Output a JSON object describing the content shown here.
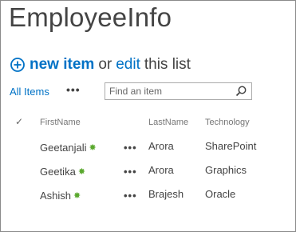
{
  "list": {
    "title": "EmployeeInfo"
  },
  "actions": {
    "new_item_label": "new item",
    "or_text": "or",
    "edit_label": "edit",
    "this_list_text": "this list"
  },
  "views": {
    "current_view": "All Items",
    "more_views_label": "•••"
  },
  "search": {
    "placeholder": "Find an item"
  },
  "table": {
    "check_header": "✓",
    "columns": [
      "FirstName",
      "LastName",
      "Technology"
    ],
    "rows": [
      {
        "first": "Geetanjali",
        "last": "Arora",
        "tech": "SharePoint",
        "new_badge": "✸",
        "menu": "•••"
      },
      {
        "first": "Geetika",
        "last": "Arora",
        "tech": "Graphics",
        "new_badge": "✸",
        "menu": "•••"
      },
      {
        "first": "Ashish",
        "last": "Brajesh",
        "tech": "Oracle",
        "new_badge": "✸",
        "menu": "•••"
      }
    ]
  },
  "colors": {
    "link": "#0072c6",
    "text": "#444444",
    "new_badge": "#5aa82e"
  },
  "icons": {
    "add": "plus-circle-icon",
    "search": "search-icon",
    "new_item_badge": "new-item-icon"
  }
}
